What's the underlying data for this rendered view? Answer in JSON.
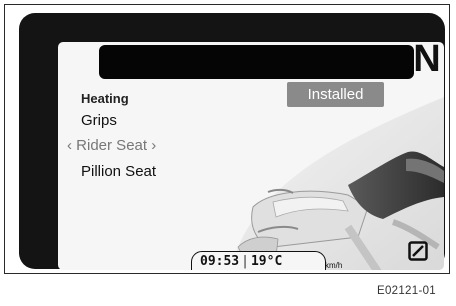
{
  "gear": "N",
  "menu": {
    "heading": "Heating",
    "items": [
      {
        "label": "Grips"
      },
      {
        "label": "Rider Seat",
        "selected": true
      },
      {
        "label": "Pillion Seat"
      }
    ],
    "chevron_left": "‹",
    "chevron_right": "›"
  },
  "status": {
    "label": "Installed"
  },
  "footer": {
    "time": "09:53",
    "separator": "|",
    "temperature": "19°C",
    "speed_unit": "km/h"
  },
  "icons": {
    "corner": "abs-off-icon"
  },
  "caption": "E02121-01"
}
